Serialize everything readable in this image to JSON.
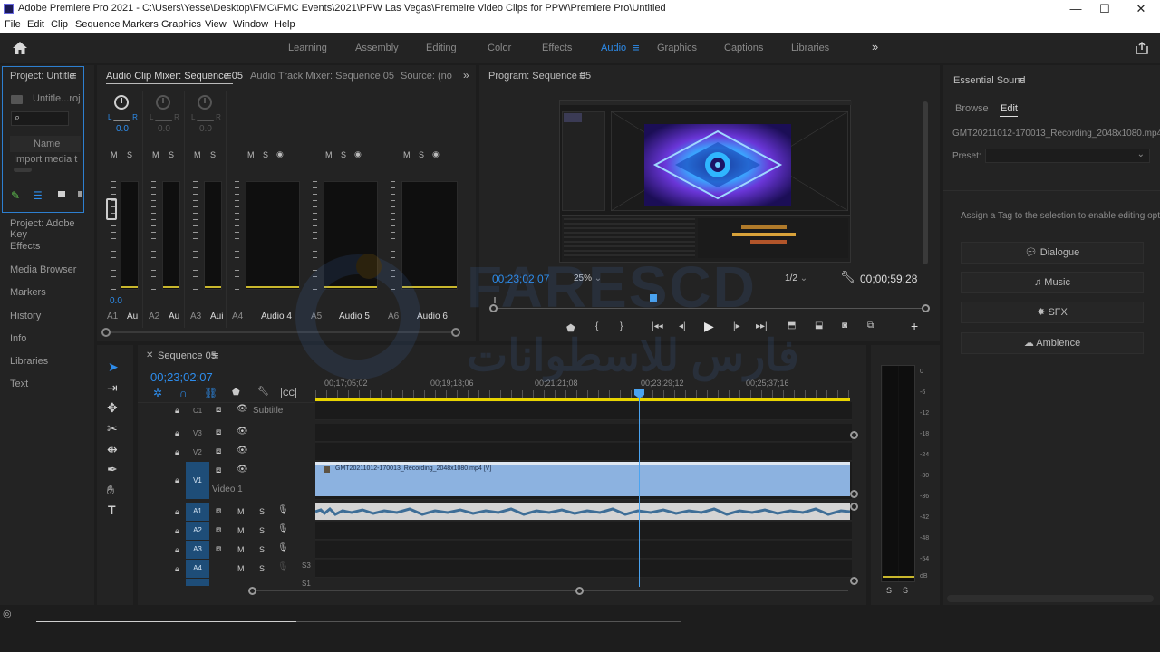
{
  "window": {
    "title": "Adobe Premiere Pro 2021 - C:\\Users\\Yesse\\Desktop\\FMC\\FMC Events\\2021\\PPW Las Vegas\\Premeire Video Clips for PPW\\Premiere Pro\\Untitled",
    "minimize": "—",
    "maximize": "☐",
    "close": "✕"
  },
  "menu": [
    "File",
    "Edit",
    "Clip",
    "Sequence",
    "Markers",
    "Graphics",
    "View",
    "Window",
    "Help"
  ],
  "workspaces": [
    "Learning",
    "Assembly",
    "Editing",
    "Color",
    "Effects",
    "Audio",
    "Graphics",
    "Captions",
    "Libraries"
  ],
  "workspaces_more": "»",
  "project": {
    "tab": "Project: Untitle",
    "item": "Untitle...roj",
    "column": "Name",
    "import_text": "Import media t",
    "items": [
      "Project: Adobe Key",
      "Effects",
      "Media Browser",
      "Markers",
      "History",
      "Info",
      "Libraries",
      "Text"
    ]
  },
  "mixer": {
    "tabs": [
      "Audio Clip Mixer: Sequence 05",
      "Audio Track Mixer: Sequence 05",
      "Source: (no"
    ],
    "lr": "L",
    "lr_r": "R",
    "pan_value": "0.0",
    "pan_value_off": "0.0",
    "fader_value": "0.0",
    "ms": [
      "M",
      "S"
    ],
    "channels": [
      {
        "id": "A1",
        "name": "Au"
      },
      {
        "id": "A2",
        "name": "Au"
      },
      {
        "id": "A3",
        "name": "Aui"
      },
      {
        "id": "A4",
        "name": "Audio 4"
      },
      {
        "id": "A5",
        "name": "Audio 5"
      },
      {
        "id": "A6",
        "name": "Audio 6"
      }
    ]
  },
  "program": {
    "tab": "Program: Sequence 05",
    "timecode": "00;23;02;07",
    "zoom": "25%",
    "resolution": "1/2",
    "duration": "00;00;59;28"
  },
  "essential": {
    "title": "Essential Sound",
    "tabs": [
      "Browse",
      "Edit"
    ],
    "clip": "GMT20211012-170013_Recording_2048x1080.mp4",
    "preset_label": "Preset:",
    "hint": "Assign a Tag to the selection to enable editing option",
    "buttons": [
      "Dialogue",
      "Music",
      "SFX",
      "Ambience"
    ]
  },
  "timeline": {
    "tab": "Sequence 05",
    "timecode": "00;23;02;07",
    "ruler": [
      "00;17;05;02",
      "00;19;13;06",
      "00;21;21;08",
      "00;23;29;12",
      "00;25;37;16"
    ],
    "subtitle_track": "C1",
    "subtitle_label": "Subtitle",
    "video_tracks": [
      "V3",
      "V2",
      "V1"
    ],
    "video1_label": "Video 1",
    "audio_tracks": [
      "A1",
      "A2",
      "A3",
      "A4"
    ],
    "clip_label": "GMT20211012-170013_Recording_2048x1080.mp4 [V]",
    "audio_extra": "S3",
    "audio_extra2": "S1"
  },
  "meters": {
    "scale": [
      "0",
      "-6",
      "-12",
      "-18",
      "-24",
      "-30",
      "-36",
      "-42",
      "-48",
      "-54",
      "dB"
    ],
    "solo": [
      "S",
      "S"
    ]
  },
  "watermark": {
    "latin": "FARESCD",
    "arabic": "فارس للاسطوانات"
  },
  "colors": {
    "accent": "#2d8ceb",
    "clip": "#8cb2e0",
    "playhead": "#4aa3f0",
    "workarea": "#e8d400"
  }
}
